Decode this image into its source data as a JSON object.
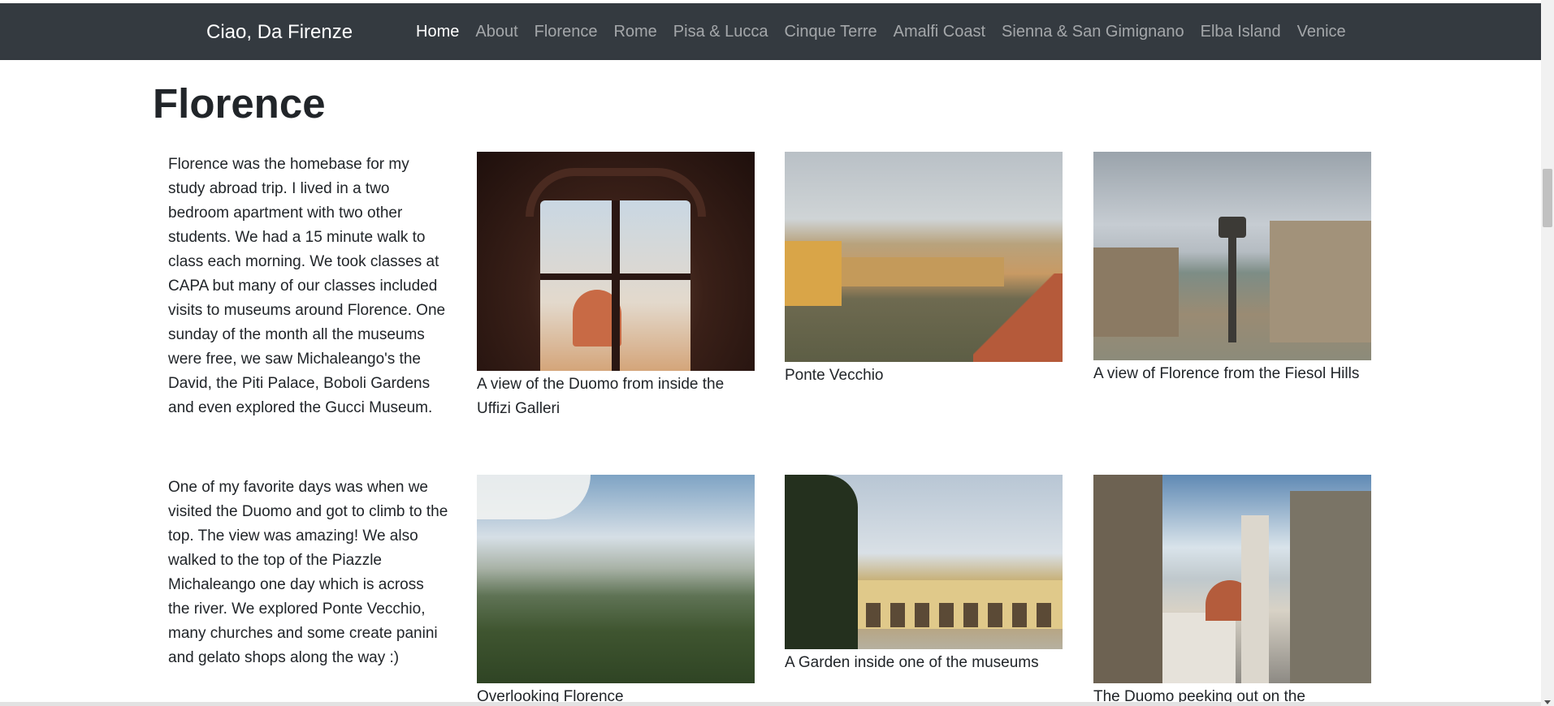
{
  "navbar": {
    "brand": "Ciao, Da Firenze",
    "links": [
      "Home",
      "About",
      "Florence",
      "Rome",
      "Pisa & Lucca",
      "Cinque Terre",
      "Amalfi Coast",
      "Sienna & San Gimignano",
      "Elba Island",
      "Venice"
    ],
    "active": "Home"
  },
  "main": {
    "title": "Florence",
    "paragraphs": [
      "Florence was the homebase for my study abroad trip. I lived in a two bedroom apartment with two other students. We had a 15 minute walk to class each morning. We took classes at CAPA but many of our classes included visits to museums around Florence. One sunday of the month all the museums were free, we saw Michaleango's the David, the Piti Palace, Boboli Gardens and even explored the Gucci Museum.",
      "One of my favorite days was when we visited the Duomo and got to climb to the top. The view was amazing! We also walked to the top of the Piazzle Michaleango one day which is across the river. We explored Ponte Vecchio, many churches and some create panini and gelato shops along the way :)"
    ],
    "photos": [
      {
        "caption": "A view of the Duomo from inside the Uffizi Galleri"
      },
      {
        "caption": "Ponte Vecchio"
      },
      {
        "caption": "A view of Florence from the Fiesol Hills"
      },
      {
        "caption": "Overlooking Florence"
      },
      {
        "caption": "A Garden inside one of the museums"
      },
      {
        "caption": "The Duomo peeking out on the"
      }
    ]
  },
  "colors": {
    "navbar_bg": "#343a40",
    "nav_active": "#ffffff",
    "nav_inactive": "rgba(255,255,255,0.55)",
    "text": "#212529"
  }
}
